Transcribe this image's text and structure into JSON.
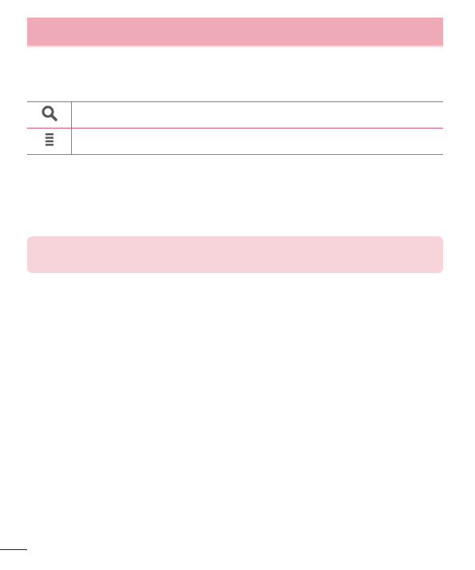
{
  "header": {
    "title": ""
  },
  "icon_table": {
    "rows": [
      {
        "icon": "search-icon",
        "description": ""
      },
      {
        "icon": "menu-icon",
        "description": ""
      }
    ]
  },
  "note": {
    "text": ""
  },
  "colors": {
    "header_bg": "#eeabb7",
    "table_rule": "#d8577a",
    "note_bg": "#f7d4da",
    "icon_gray": "#555555"
  }
}
